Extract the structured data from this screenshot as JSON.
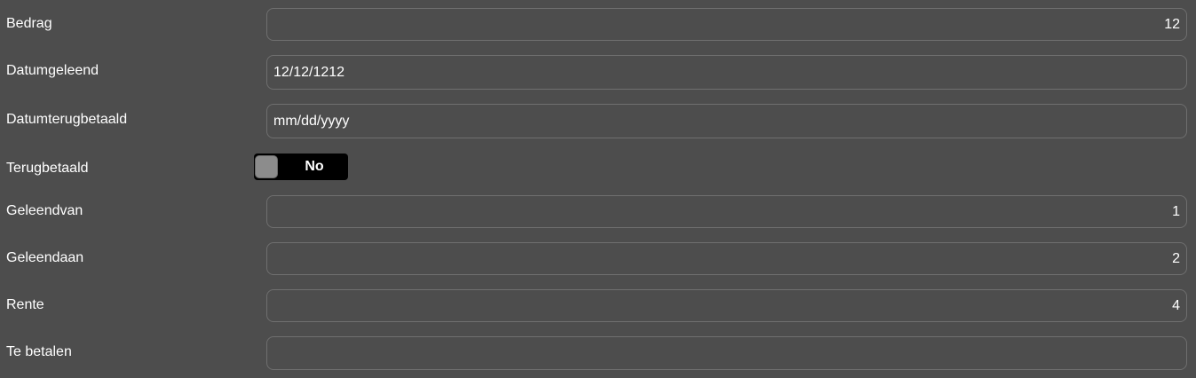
{
  "form": {
    "bedrag": {
      "label": "Bedrag",
      "value": "12"
    },
    "datumgeleend": {
      "label": "Datumgeleend",
      "value": "12/12/1212"
    },
    "datumterugbetaald": {
      "label": "Datumterugbetaald",
      "value": "mm/dd/yyyy"
    },
    "terugbetaald": {
      "label": "Terugbetaald",
      "toggle_text": "No"
    },
    "geleendvan": {
      "label": "Geleendvan",
      "value": "1"
    },
    "geleendaan": {
      "label": "Geleendaan",
      "value": "2"
    },
    "rente": {
      "label": "Rente",
      "value": "4"
    },
    "te_betalen": {
      "label": "Te betalen",
      "value": ""
    }
  },
  "colors": {
    "background": "#4d4d4d",
    "field_border": "#6f6f6f",
    "toggle_background": "#000000",
    "toggle_knob": "#8c8c8c"
  },
  "icons": {
    "toggle_knob": "switch-knob"
  }
}
